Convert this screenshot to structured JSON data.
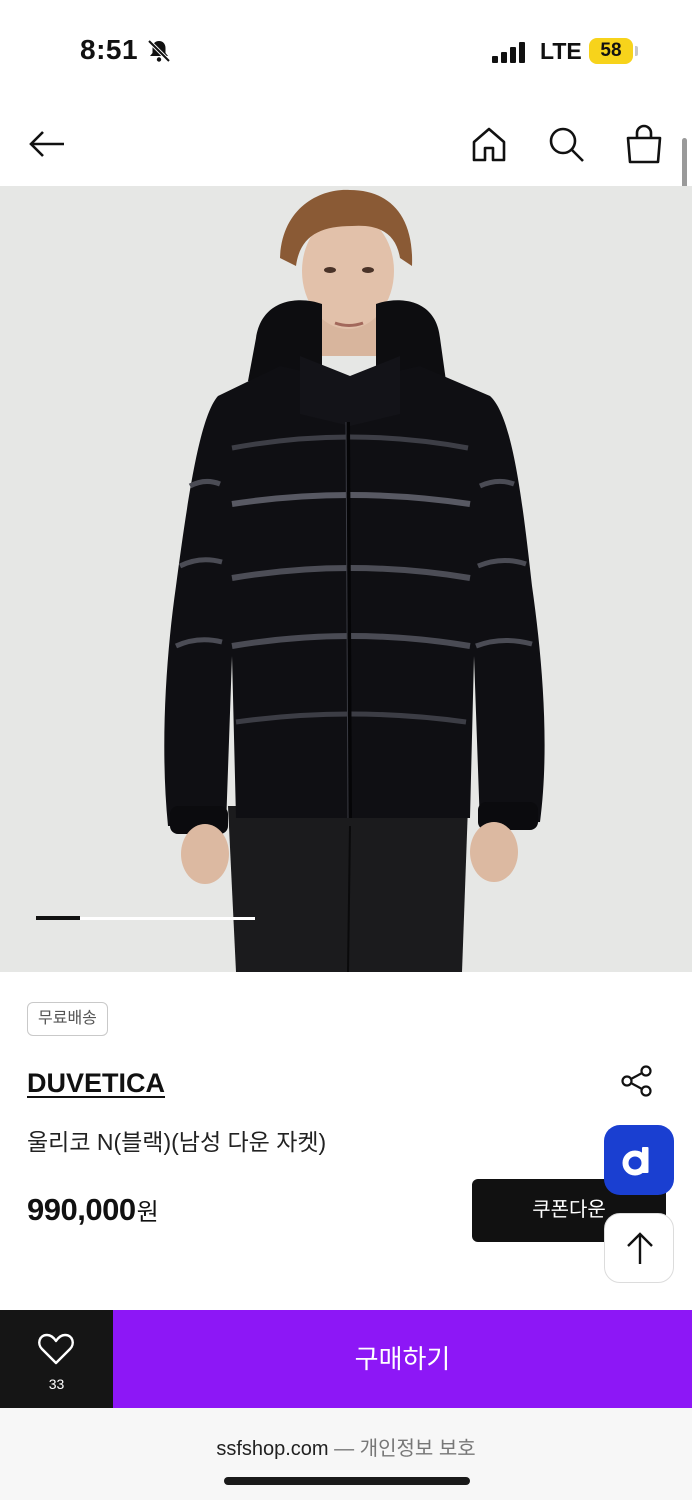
{
  "status_bar": {
    "time": "8:51",
    "network": "LTE",
    "battery": "58"
  },
  "nav": {
    "icons": [
      "back-arrow-icon",
      "home-icon",
      "search-icon",
      "shopping-bag-icon"
    ]
  },
  "carousel": {
    "current_fraction": 0.2
  },
  "product": {
    "badge": "무료배송",
    "brand": "DUVETICA",
    "title": "울리코 N(블랙)(남성 다운 자켓)",
    "price": "990,000",
    "price_unit": "원",
    "coupon_label": "쿠폰다운"
  },
  "floating": {
    "app_badge_letter": "d"
  },
  "bottom_bar": {
    "wish_count": "33",
    "buy_label": "구매하기"
  },
  "browser": {
    "domain": "ssfshop.com",
    "separator": " — ",
    "privacy_label": "개인정보 보호"
  },
  "colors": {
    "buy_button": "#8d17f6",
    "app_badge": "#1a3fd1",
    "battery": "#f7d31b"
  }
}
